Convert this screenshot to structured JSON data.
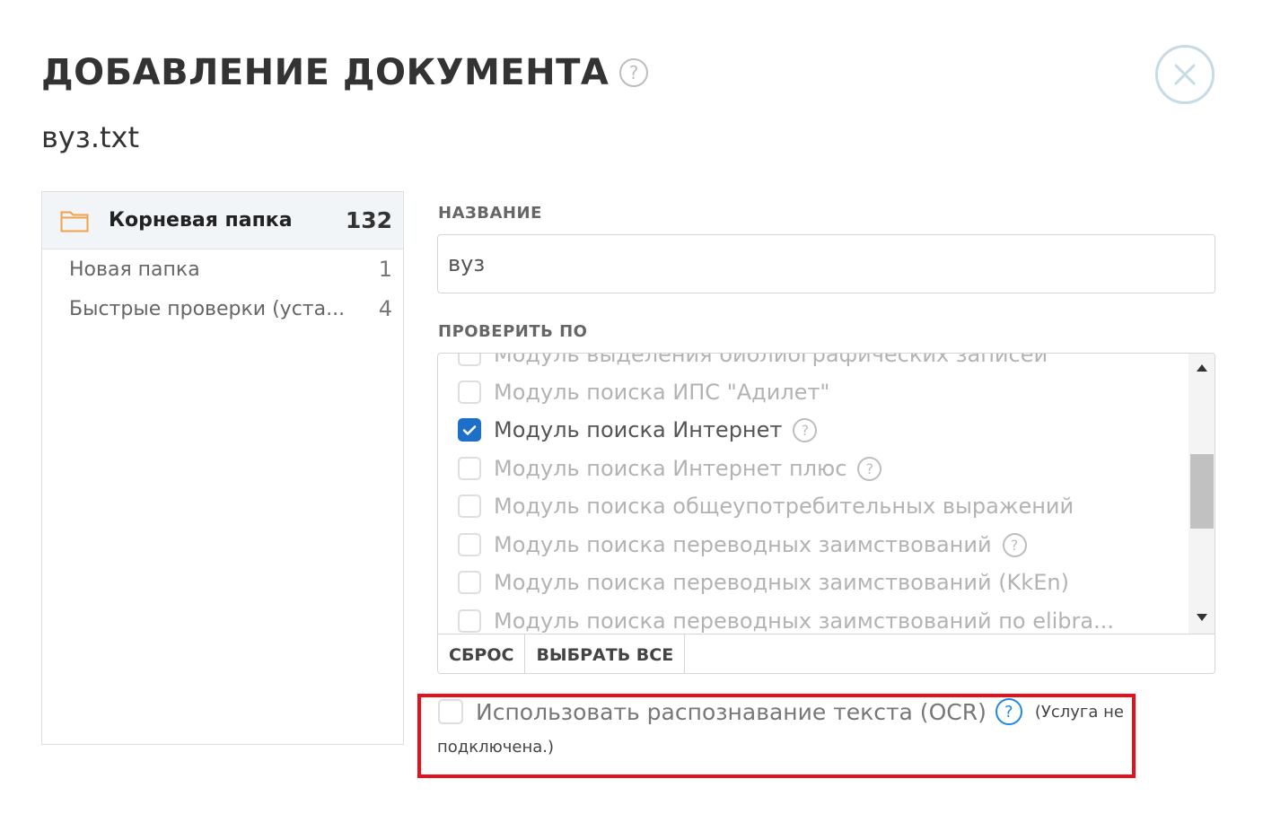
{
  "dialog": {
    "title": "ДОБАВЛЕНИЕ ДОКУМЕНТА",
    "title_help": "?",
    "filename": "вуз.txt"
  },
  "folders": {
    "root": {
      "label": "Корневая папка",
      "count": "132"
    },
    "items": [
      {
        "label": "Новая папка",
        "count": "1"
      },
      {
        "label": "Быстрые проверки (уста...",
        "count": "4"
      }
    ]
  },
  "name_field": {
    "label": "НАЗВАНИЕ",
    "value": "вуз"
  },
  "check_by": {
    "label": "ПРОВЕРИТЬ ПО",
    "modules": [
      {
        "label": "Модуль выделения библиографических записей",
        "checked": false,
        "has_help": false
      },
      {
        "label": "Модуль поиска ИПС \"Адилет\"",
        "checked": false,
        "has_help": false
      },
      {
        "label": "Модуль поиска Интернет",
        "checked": true,
        "has_help": true
      },
      {
        "label": "Модуль поиска Интернет плюс",
        "checked": false,
        "has_help": true
      },
      {
        "label": "Модуль поиска общеупотребительных выражений",
        "checked": false,
        "has_help": false
      },
      {
        "label": "Модуль поиска переводных заимствований",
        "checked": false,
        "has_help": true
      },
      {
        "label": "Модуль поиска переводных заимствований (KkEn)",
        "checked": false,
        "has_help": false
      },
      {
        "label": "Модуль поиска переводных заимствований по elibra...",
        "checked": false,
        "has_help": false
      }
    ],
    "help_glyph": "?",
    "reset_label": "СБРОС",
    "select_all_label": "ВЫБРАТЬ ВСЕ"
  },
  "ocr": {
    "label": "Использовать распознавание текста (OCR)",
    "help": "?",
    "note_line1": "(Услуга не",
    "note_line2": "подключена.)",
    "checked": false
  },
  "colors": {
    "accent_blue": "#1e6fc8",
    "highlight_red": "#e8101a",
    "muted_text": "#b3b3b3"
  }
}
